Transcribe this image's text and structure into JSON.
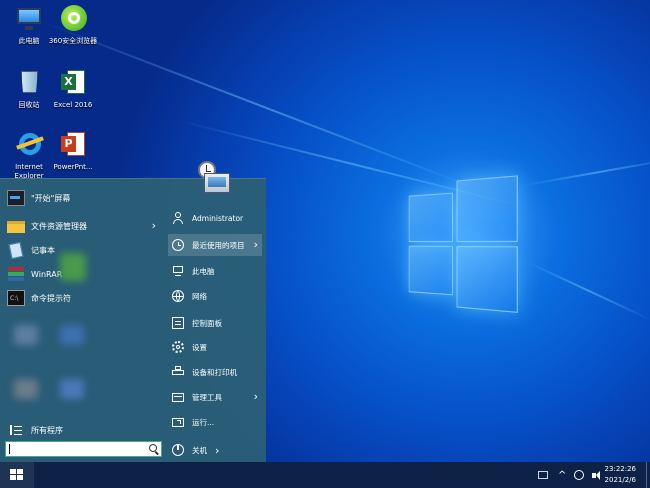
{
  "desktop": {
    "icons": [
      {
        "label": "此电脑"
      },
      {
        "label": "360安全浏览器"
      },
      {
        "label": "回收站"
      },
      {
        "label": "Excel 2016"
      },
      {
        "label": "Internet Explorer"
      },
      {
        "label": "PowerPnt..."
      }
    ]
  },
  "start_menu": {
    "left": {
      "items": [
        {
          "label": "\"开始\"屏幕"
        },
        {
          "label": "文件资源管理器"
        },
        {
          "label": "记事本"
        },
        {
          "label": "WinRAR"
        },
        {
          "label": "命令提示符"
        }
      ],
      "all_programs": "所有程序",
      "search_placeholder": ""
    },
    "right": {
      "user": "Administrator",
      "items": [
        {
          "label": "最近使用的项目"
        },
        {
          "label": "此电脑"
        },
        {
          "label": "网络"
        },
        {
          "label": "控制面板"
        },
        {
          "label": "设置"
        },
        {
          "label": "设备和打印机"
        },
        {
          "label": "管理工具"
        },
        {
          "label": "运行..."
        }
      ],
      "shutdown": "关机"
    }
  },
  "taskbar": {
    "time": "23:22:26",
    "date": "2021/2/6"
  },
  "colors": {
    "start_menu_bg": "#2c6074",
    "taskbar_bg": "#0d2246",
    "accent": "#0b6fe0"
  }
}
